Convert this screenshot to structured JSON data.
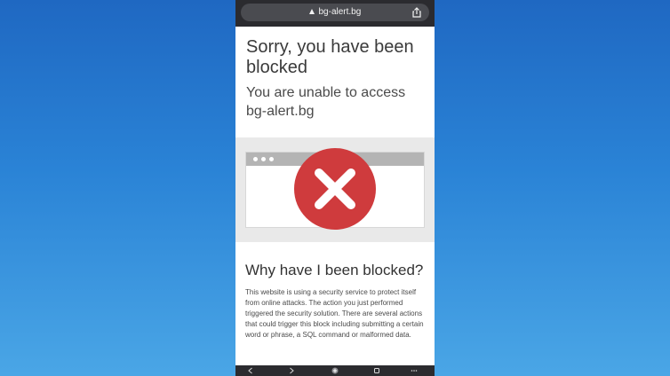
{
  "browser": {
    "url": "bg-alert.bg",
    "icons": {
      "lock": "lock-icon",
      "share": "share-icon",
      "back": "back-icon",
      "forward": "forward-icon",
      "new_tab": "plus-icon",
      "tabs": "tabs-icon",
      "more": "more-icon"
    }
  },
  "page": {
    "title": "Sorry, you have been blocked",
    "subtitle": "You are unable to access bg-alert.bg",
    "section_title": "Why have I been blocked?",
    "body_text": "This website is using a security service to protect itself from online attacks. The action you just performed triggered the security solution. There are several actions that could trigger this block including submitting a certain word or phrase, a SQL command or malformed data."
  },
  "colors": {
    "background_gradient_top": "#1f68c2",
    "background_gradient_bottom": "#4aa6e6",
    "alert_red": "#cf3b3d",
    "hero_gray": "#e9e9e9"
  }
}
